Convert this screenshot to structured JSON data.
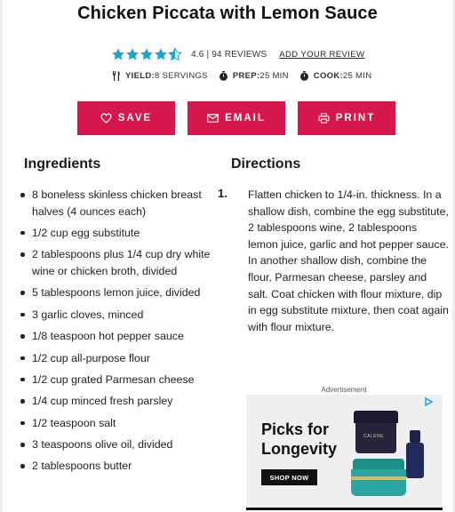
{
  "recipe": {
    "title": "Chicken Piccata with Lemon Sauce"
  },
  "rating": {
    "value": 4.6,
    "text": "4.6 | 94 REVIEWS",
    "add_review_label": "ADD YOUR REVIEW",
    "star_color": "#1aa3d9"
  },
  "meta": {
    "yield_label": "YIELD:",
    "yield_value": "8 SERVINGS",
    "prep_label": "PREP:",
    "prep_value": "25 MIN",
    "cook_label": "COOK:",
    "cook_value": "25 MIN"
  },
  "actions": {
    "save_label": "SAVE",
    "email_label": "EMAIL",
    "print_label": "PRINT",
    "button_color": "#d5174e"
  },
  "ingredients": {
    "heading": "Ingredients",
    "items": [
      "8 boneless skinless chicken breast halves (4 ounces each)",
      "1/2 cup egg substitute",
      "2 tablespoons plus 1/4 cup dry white wine or chicken broth, divided",
      "5 tablespoons lemon juice, divided",
      "3 garlic cloves, minced",
      "1/8 teaspoon hot pepper sauce",
      "1/2 cup all-purpose flour",
      "1/2 cup grated Parmesan cheese",
      "1/4 cup minced fresh parsley",
      "1/2 teaspoon salt",
      "3 teaspoons olive oil, divided",
      "2 tablespoons butter"
    ]
  },
  "directions": {
    "heading": "Directions",
    "steps": [
      {
        "number": "1.",
        "text": "Flatten chicken to 1/4-in. thickness. In a shallow dish, combine the egg substitute, 2 tablespoons wine, 2 tablespoons lemon juice, garlic and hot pepper sauce. In another shallow dish, combine the flour, Parmesan cheese, parsley and salt. Coat chicken with flour mixture, dip in egg substitute mixture, then coat again with flour mixture."
      }
    ]
  },
  "ad": {
    "label": "Advertisement",
    "headline_line1": "Picks for",
    "headline_line2": "Longevity",
    "cta": "SHOP NOW",
    "product_label": "CALENE"
  }
}
